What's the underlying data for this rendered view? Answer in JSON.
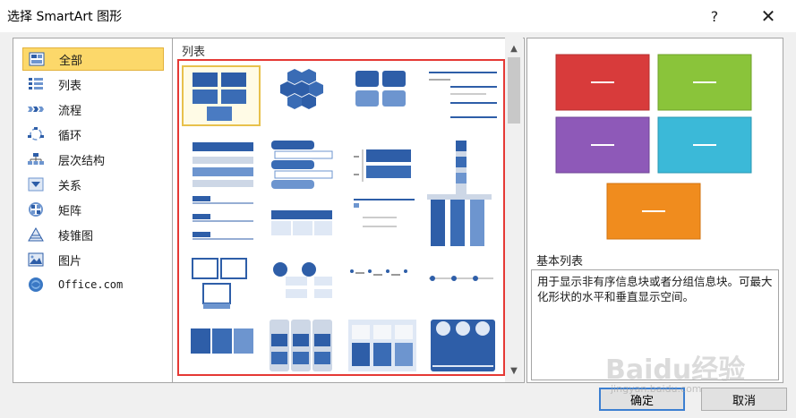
{
  "window": {
    "title": "选择 SmartArt 图形",
    "help": "?",
    "close": "✕"
  },
  "categories": [
    {
      "label": "全部",
      "icon": "all-icon",
      "selected": true
    },
    {
      "label": "列表",
      "icon": "list-icon"
    },
    {
      "label": "流程",
      "icon": "process-icon"
    },
    {
      "label": "循环",
      "icon": "cycle-icon"
    },
    {
      "label": "层次结构",
      "icon": "hierarchy-icon"
    },
    {
      "label": "关系",
      "icon": "relationship-icon"
    },
    {
      "label": "矩阵",
      "icon": "matrix-icon"
    },
    {
      "label": "棱锥图",
      "icon": "pyramid-icon"
    },
    {
      "label": "图片",
      "icon": "picture-icon"
    },
    {
      "label": "Office.com",
      "icon": "office-icon"
    }
  ],
  "gallery": {
    "header": "列表"
  },
  "preview": {
    "title": "基本列表",
    "description": "用于显示非有序信息块或者分组信息块。可最大化形状的水平和垂直显示空间。",
    "shape_colors": [
      "#d83b3b",
      "#8ac43a",
      "#8e59b8",
      "#3bb9d8",
      "#f08c1e"
    ]
  },
  "buttons": {
    "ok": "确定",
    "cancel": "取消"
  },
  "watermark": {
    "text": "Baidu经验",
    "url": "jingyan.baidu.com"
  },
  "accent": "#2e5ea8",
  "highlight": "#e53935"
}
